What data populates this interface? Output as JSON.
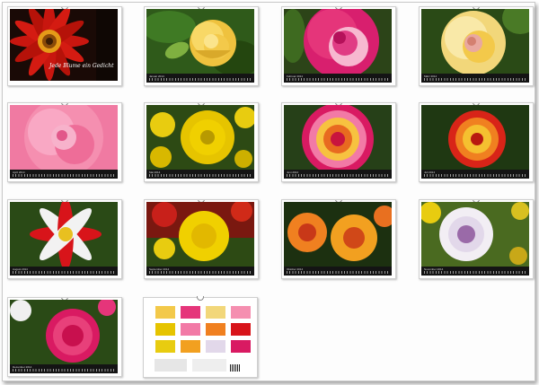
{
  "cover": {
    "title": "Jede Blume ein Gedicht"
  },
  "pages": [
    {
      "key": "cover",
      "month": ""
    },
    {
      "key": "jan",
      "month": "Januar 2014"
    },
    {
      "key": "feb",
      "month": "Februar 2014"
    },
    {
      "key": "mar",
      "month": "März 2014"
    },
    {
      "key": "apr",
      "month": "April 2014"
    },
    {
      "key": "may",
      "month": "Mai 2014"
    },
    {
      "key": "jun",
      "month": "Juni 2014"
    },
    {
      "key": "jul",
      "month": "Juli 2014"
    },
    {
      "key": "aug",
      "month": "August 2014"
    },
    {
      "key": "sep",
      "month": "September 2014"
    },
    {
      "key": "oct",
      "month": "Oktober 2014"
    },
    {
      "key": "nov",
      "month": "November 2014"
    },
    {
      "key": "dec",
      "month": "Dezember 2014"
    }
  ],
  "colors": {
    "calendar_strip": "#141414",
    "cover_bg": "#1a0a06",
    "red_petals": "#c8160f",
    "yellow_rose": "#f3c94a",
    "pink_rose": "#e5357a",
    "light_pink": "#f58fb0",
    "dahlia_yellow": "#f0d000",
    "dahlia_magenta": "#d91a62",
    "dahlia_orange": "#f08020",
    "white_dahlia": "#f2eef4",
    "leaf_green": "#2f5a1a"
  }
}
